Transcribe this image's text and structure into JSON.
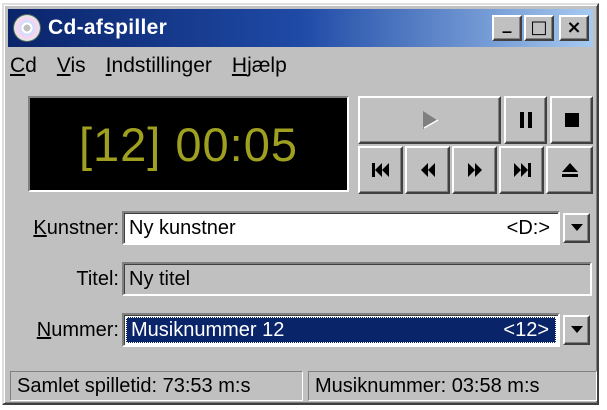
{
  "window": {
    "title": "Cd-afspiller",
    "controls": {
      "minimize": "_",
      "maximize": "□",
      "close": "×"
    }
  },
  "menu": {
    "items": [
      {
        "accel": "C",
        "rest": "d"
      },
      {
        "accel": "V",
        "rest": "is"
      },
      {
        "accel": "I",
        "rest": "ndstillinger"
      },
      {
        "accel": "H",
        "rest": "jælp"
      }
    ]
  },
  "display": {
    "text": "[12] 00:05",
    "color": "#a0a020"
  },
  "buttons": {
    "play": "play-icon",
    "pause": "pause-icon",
    "stop": "stop-icon",
    "previous_track": "skip-back-icon",
    "rewind": "rewind-icon",
    "fast_forward": "fast-forward-icon",
    "next_track": "skip-forward-icon",
    "eject": "eject-icon"
  },
  "fields": {
    "artist": {
      "label_accel": "K",
      "label_rest": "unstner:",
      "value": "Ny kunstner",
      "drive": "<D:>"
    },
    "title": {
      "label": "Titel:",
      "value": "Ny titel"
    },
    "track": {
      "label_accel": "N",
      "label_rest": "ummer:",
      "value": "Musiknummer 12",
      "tag": "<12>"
    }
  },
  "status": {
    "total": "Samlet spilletid: 73:53 m:s",
    "track": "Musiknummer: 03:58 m:s"
  },
  "colors": {
    "titlebar_start": "#0a246a",
    "selection": "#0a246a",
    "face": "#c0c0c0"
  }
}
